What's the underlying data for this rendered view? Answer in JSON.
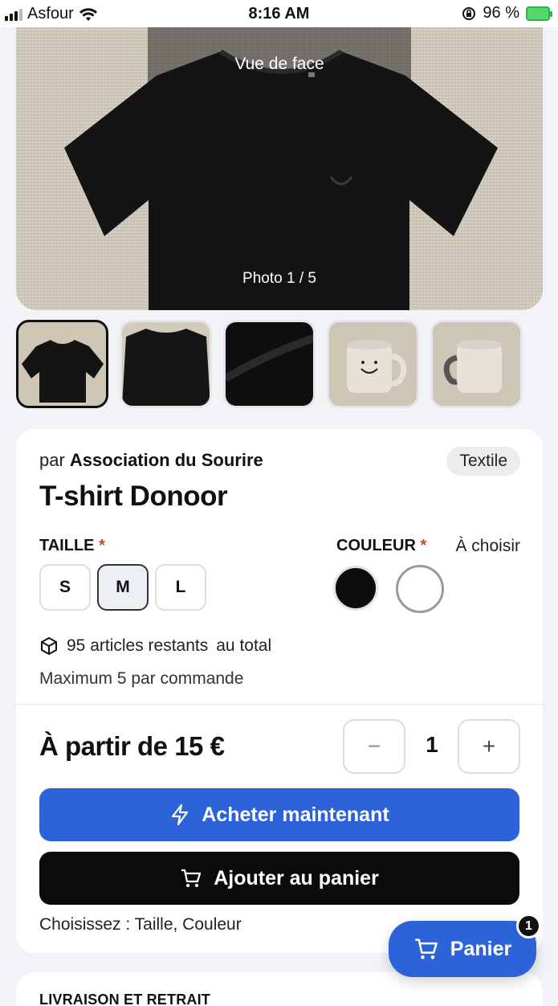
{
  "status_bar": {
    "carrier": "Asfour",
    "time": "8:16 AM",
    "battery": "96 %"
  },
  "gallery": {
    "view_label": "Vue de face",
    "counter": "Photo 1 / 5",
    "thumb_count": 5,
    "active_index": 0
  },
  "product": {
    "by_prefix": "par",
    "seller": "Association du Sourire",
    "category": "Textile",
    "title": "T-shirt Donoor",
    "size_label": "TAILLE",
    "color_label": "COULEUR",
    "required_mark": "*",
    "color_hint": "À choisir",
    "sizes": [
      "S",
      "M",
      "L"
    ],
    "selected_size": "M",
    "colors": [
      "#0d0d0d",
      "#ffffff"
    ],
    "stock_text": "95 articles restants",
    "stock_suffix": "au total",
    "max_text": "Maximum 5 par commande",
    "price_text": "À partir de 15 €",
    "quantity": "1",
    "minus": "−",
    "plus": "+",
    "buy_label": "Acheter maintenant",
    "cart_label": "Ajouter au panier",
    "hint": "Choisissez : Taille, Couleur"
  },
  "cart_fab": {
    "label": "Panier",
    "count": "1"
  },
  "delivery": {
    "heading": "LIVRAISON ET RETRAIT"
  },
  "colors": {
    "accent": "#2d63d8",
    "dark": "#0b0b0b",
    "required": "#d0402b"
  }
}
